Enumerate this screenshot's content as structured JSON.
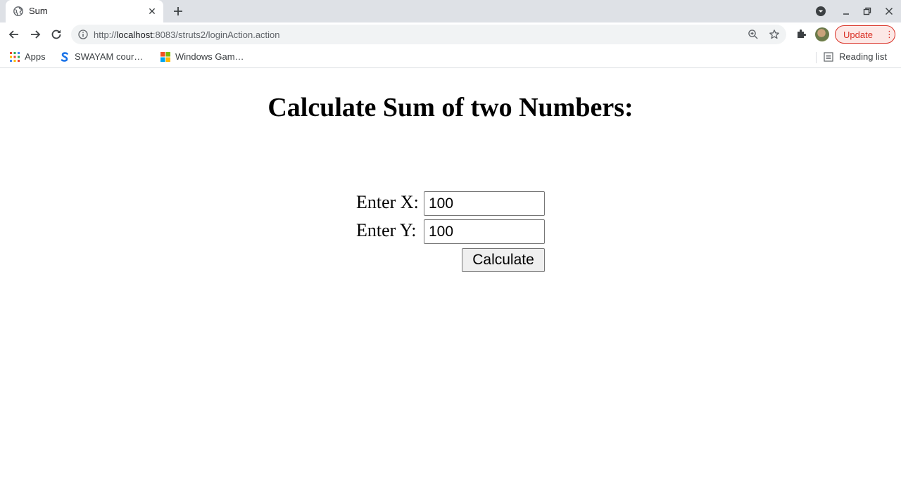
{
  "browser": {
    "tab": {
      "title": "Sum",
      "close_glyph": "✕"
    },
    "new_tab_icon": "plus-icon",
    "address_bar": {
      "scheme": "http://",
      "host": "localhost",
      "path": ":8083/struts2/loginAction.action"
    },
    "update_button": {
      "label": "Update",
      "menu_glyph": "⋮",
      "accent": "#d93025"
    },
    "bookmarks": [
      {
        "label": "Apps",
        "icon": "apps-grid-icon"
      },
      {
        "label": "SWAYAM cour…",
        "icon": "swayam-icon"
      },
      {
        "label": "Windows Gam…",
        "icon": "windows-logo-icon"
      }
    ],
    "reading_list": {
      "label": "Reading list",
      "icon": "reading-list-icon"
    }
  },
  "page": {
    "title": "Calculate Sum of two Numbers:",
    "form": {
      "x_label": "Enter X:",
      "x_value": "100",
      "y_label": "Enter Y:",
      "y_value": "100",
      "submit_label": "Calculate"
    }
  }
}
